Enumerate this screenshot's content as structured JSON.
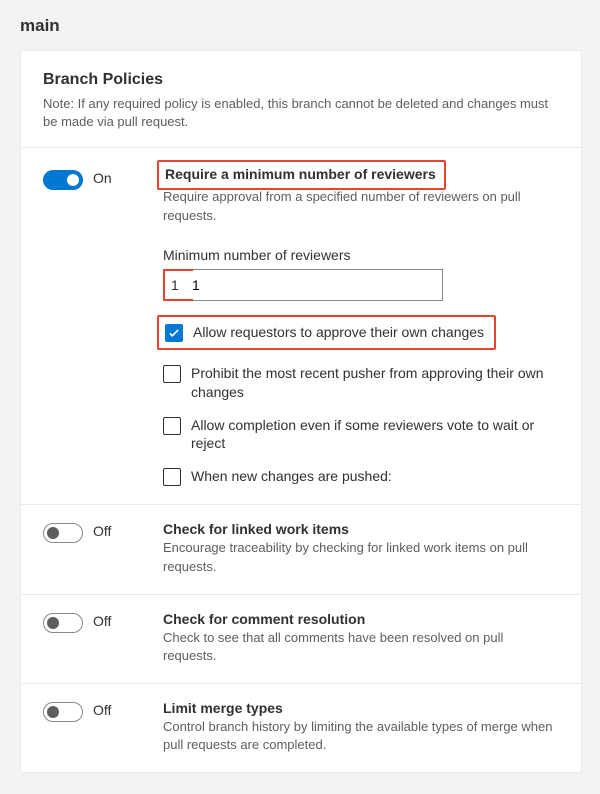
{
  "page_title": "main",
  "header": {
    "title": "Branch Policies",
    "note": "Note: If any required policy is enabled, this branch cannot be deleted and changes must be made via pull request."
  },
  "toggle_states": {
    "on": "On",
    "off": "Off"
  },
  "policies": {
    "min_reviewers": {
      "title": "Require a minimum number of reviewers",
      "desc": "Require approval from a specified number of reviewers on pull requests.",
      "field_label": "Minimum number of reviewers",
      "value": "1",
      "options": {
        "allow_self": "Allow requestors to approve their own changes",
        "prohibit_pusher": "Prohibit the most recent pusher from approving their own changes",
        "allow_completion": "Allow completion even if some reviewers vote to wait or reject",
        "when_new_changes": "When new changes are pushed:"
      }
    },
    "linked_items": {
      "title": "Check for linked work items",
      "desc": "Encourage traceability by checking for linked work items on pull requests."
    },
    "comment_resolution": {
      "title": "Check for comment resolution",
      "desc": "Check to see that all comments have been resolved on pull requests."
    },
    "limit_merge": {
      "title": "Limit merge types",
      "desc": "Control branch history by limiting the available types of merge when pull requests are completed."
    }
  }
}
